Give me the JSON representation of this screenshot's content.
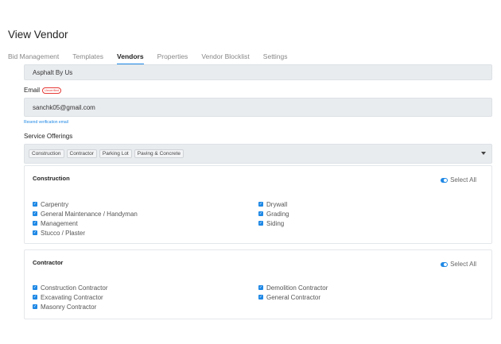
{
  "page": {
    "title": "View Vendor"
  },
  "tabs": [
    {
      "label": "Bid Management"
    },
    {
      "label": "Templates"
    },
    {
      "label": "Vendors",
      "active": true
    },
    {
      "label": "Properties"
    },
    {
      "label": "Vendor Blocklist"
    },
    {
      "label": "Settings"
    }
  ],
  "form": {
    "company_value": "Asphalt By Us",
    "email_label": "Email",
    "email_badge": "Unverified",
    "email_value": "sanchk05@gmail.com",
    "resend_link": "Resend verification email",
    "services_label": "Service Offerings",
    "service_chips": [
      "Construction",
      "Contractor",
      "Parking Lot",
      "Paving & Concrete"
    ]
  },
  "categories": [
    {
      "title": "Construction",
      "select_all": "Select All",
      "left": [
        "Carpentry",
        "General Maintenance / Handyman",
        "Management",
        "Stucco / Plaster"
      ],
      "right": [
        "Drywall",
        "Grading",
        "Siding"
      ]
    },
    {
      "title": "Contractor",
      "select_all": "Select All",
      "left": [
        "Construction Contractor",
        "Excavating Contractor",
        "Masonry Contractor"
      ],
      "right": [
        "Demolition Contractor",
        "General Contractor"
      ]
    }
  ],
  "colors": {
    "accent": "#1e88e5",
    "badge": "#e53935",
    "field_bg": "#e9ecef"
  }
}
